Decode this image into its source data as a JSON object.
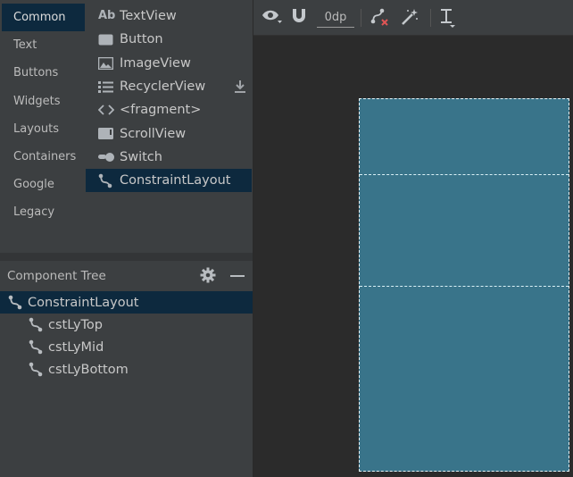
{
  "palette": {
    "categories": [
      {
        "label": "Common",
        "selected": true
      },
      {
        "label": "Text"
      },
      {
        "label": "Buttons"
      },
      {
        "label": "Widgets"
      },
      {
        "label": "Layouts"
      },
      {
        "label": "Containers"
      },
      {
        "label": "Google"
      },
      {
        "label": "Legacy"
      }
    ],
    "components": [
      {
        "label": "TextView",
        "icon": "text-ab-icon",
        "icon_text": "Ab"
      },
      {
        "label": "Button",
        "icon": "button-icon"
      },
      {
        "label": "ImageView",
        "icon": "image-icon"
      },
      {
        "label": "RecyclerView",
        "icon": "list-icon",
        "download": true
      },
      {
        "label": "<fragment>",
        "icon": "code-brackets-icon"
      },
      {
        "label": "ScrollView",
        "icon": "scrollview-icon"
      },
      {
        "label": "Switch",
        "icon": "switch-icon"
      },
      {
        "label": "ConstraintLayout",
        "icon": "constraint-icon",
        "selected": true
      }
    ]
  },
  "component_tree": {
    "title": "Component Tree",
    "items": [
      {
        "label": "ConstraintLayout",
        "level": 0,
        "selected": true
      },
      {
        "label": "cstLyTop",
        "level": 1
      },
      {
        "label": "cstLyMid",
        "level": 1
      },
      {
        "label": "cstLyBottom",
        "level": 1
      }
    ]
  },
  "toolbar": {
    "margin_value": "0dp"
  },
  "colors": {
    "panel_bg": "#3c3f41",
    "selection": "#0d293e",
    "canvas_bg": "#2b2b2b",
    "blueprint": "#39748a"
  }
}
